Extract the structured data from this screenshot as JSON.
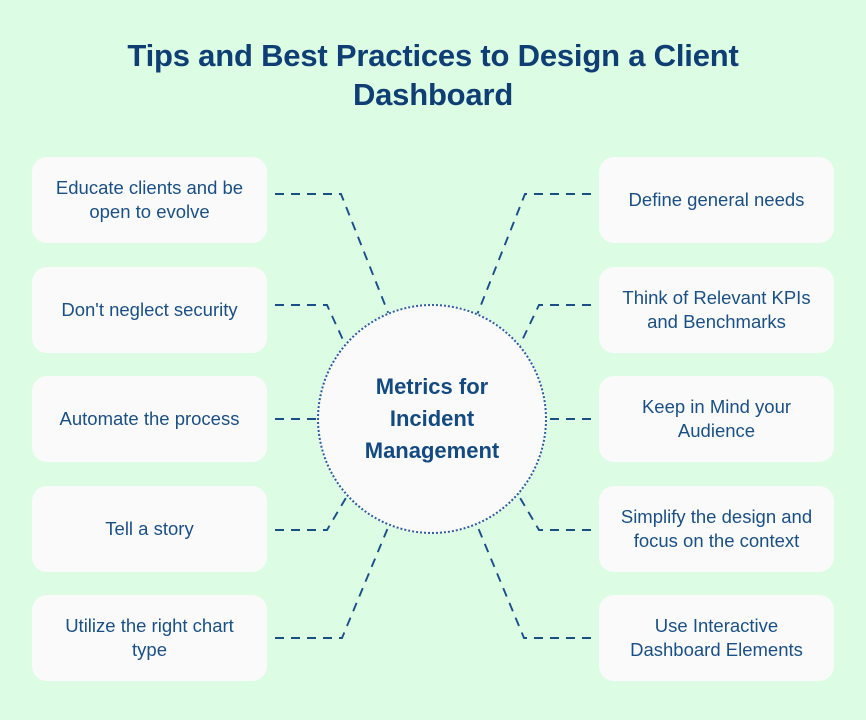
{
  "page": {
    "title": "Tips and Best Practices to Design a Client Dashboard",
    "background_color": "#dcfce4",
    "card_color": "#fafafa",
    "accent_color": "#0e3e73",
    "line_color": "#1b4f8a"
  },
  "center": {
    "label": "Metrics for Incident Management"
  },
  "left_items": [
    {
      "label": "Educate clients and be open to evolve"
    },
    {
      "label": "Don't neglect security"
    },
    {
      "label": "Automate the process"
    },
    {
      "label": "Tell a story"
    },
    {
      "label": "Utilize the right chart type"
    }
  ],
  "right_items": [
    {
      "label": "Define general needs"
    },
    {
      "label": "Think of Relevant KPIs and Benchmarks"
    },
    {
      "label": "Keep in Mind your Audience"
    },
    {
      "label": "Simplify the design and focus on the context"
    },
    {
      "label": "Use Interactive Dashboard Elements"
    }
  ]
}
